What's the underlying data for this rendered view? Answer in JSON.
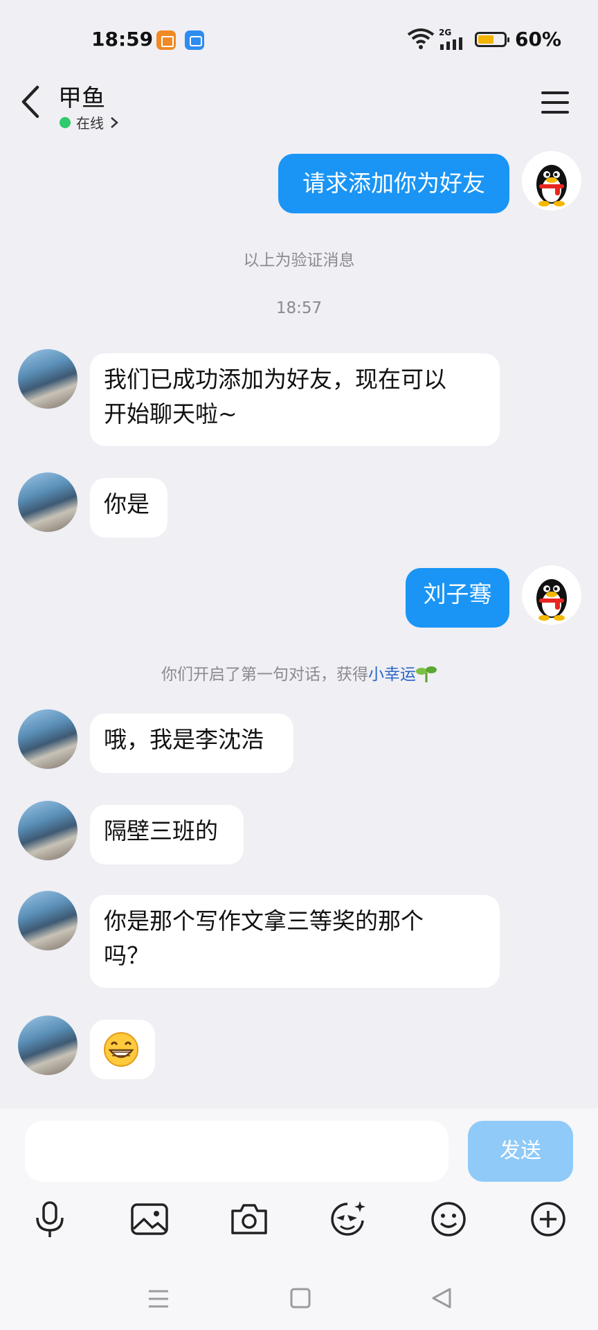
{
  "status_bar": {
    "time": "18:59",
    "network": "2G",
    "battery_text": "60%",
    "battery_level": 0.6
  },
  "header": {
    "contact_name": "甲鱼",
    "presence": "在线",
    "presence_color": "#2fca6c"
  },
  "messages": {
    "m1": "请求添加你为好友",
    "sys1": "以上为验证消息",
    "time1": "18:57",
    "m2_line1": "我们已成功添加为好友，现在可以",
    "m2_line2": "开始聊天啦~",
    "m3": "你是",
    "m4": "刘子骞",
    "sys2_prefix": "你们开启了第一句对话，获得",
    "sys2_link": "小幸运",
    "m5": "哦，我是李沈浩",
    "m6": "隔壁三班的",
    "m7_line1": "你是那个写作文拿三等奖的那个",
    "m7_line2": "吗？",
    "m8_emoji": "grinning-face-icon"
  },
  "composer": {
    "send_label": "发送",
    "accent": "#1a95f5"
  }
}
